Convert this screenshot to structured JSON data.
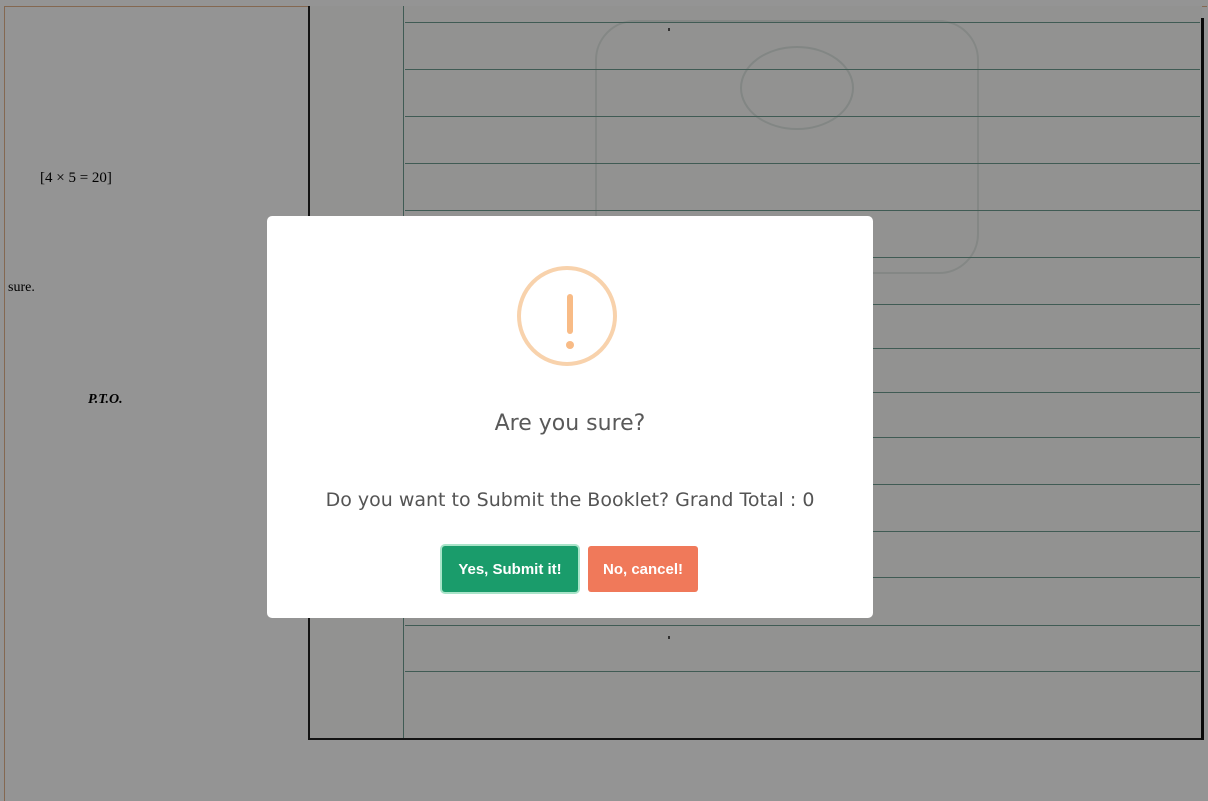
{
  "background": {
    "question_paper": {
      "marks": "[4 × 5 = 20]",
      "partial_text": "sure.",
      "pto": "P.T.O."
    }
  },
  "dialog": {
    "icon": "warning-exclamation-icon",
    "title": "Are you sure?",
    "message": "Do you want to Submit the Booklet? Grand Total : 0",
    "confirm_label": "Yes, Submit it!",
    "cancel_label": "No, cancel!"
  },
  "colors": {
    "overlay": "rgba(0,0,0,0.42)",
    "icon_border": "#f8d2ac",
    "icon_mark": "#f8bb86",
    "confirm_button": "#1a9c6b",
    "cancel_button": "#f0795a",
    "ruled_line": "#6f9e92"
  }
}
